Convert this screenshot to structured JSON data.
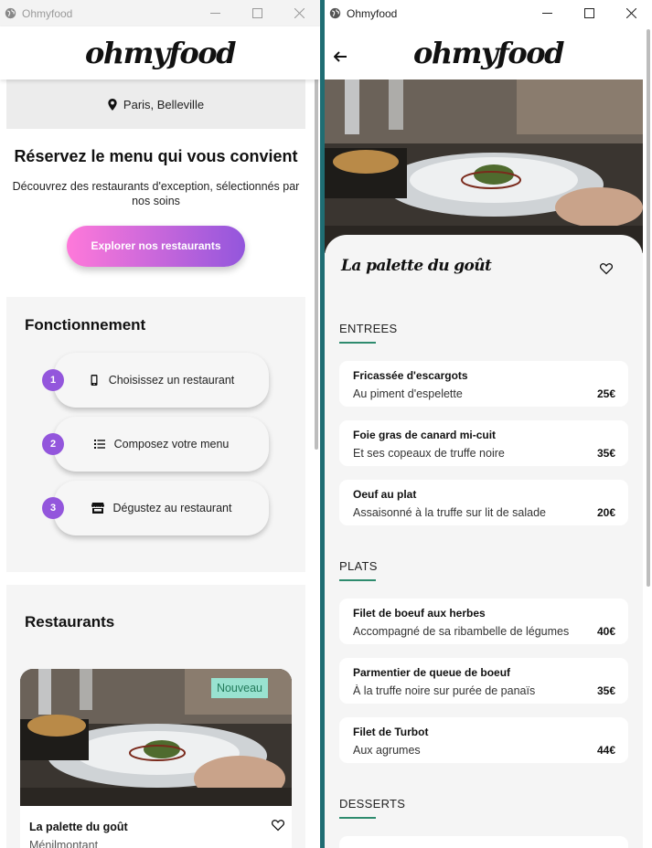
{
  "left_window": {
    "title": "Ohmyfood",
    "logo": "ohmyfood",
    "location": "Paris, Belleville",
    "hero": {
      "title": "Réservez le menu qui vous convient",
      "subtitle": "Découvrez des restaurants d'exception, sélectionnés par nos soins",
      "cta": "Explorer nos restaurants"
    },
    "how": {
      "title": "Fonctionnement",
      "steps": [
        {
          "num": "1",
          "label": "Choisissez un restaurant",
          "icon": "mobile-phone-icon"
        },
        {
          "num": "2",
          "label": "Composez votre menu",
          "icon": "list-icon"
        },
        {
          "num": "3",
          "label": "Dégustez au restaurant",
          "icon": "store-icon"
        }
      ]
    },
    "restaurants": {
      "title": "Restaurants",
      "card": {
        "badge": "Nouveau",
        "name": "La palette du goût",
        "district": "Ménilmontant"
      }
    }
  },
  "right_window": {
    "title": "Ohmyfood",
    "logo": "ohmyfood",
    "restaurant": "La palette du goût",
    "sections": [
      {
        "title": "ENTREES",
        "dishes": [
          {
            "name": "Fricassée d'escargots",
            "desc": "Au piment d'espelette",
            "price": "25€"
          },
          {
            "name": "Foie gras de canard mi-cuit",
            "desc": "Et ses copeaux de truffe noire",
            "price": "35€"
          },
          {
            "name": "Oeuf au plat",
            "desc": "Assaisonné à la truffe sur lit de salade",
            "price": "20€"
          }
        ]
      },
      {
        "title": "PLATS",
        "dishes": [
          {
            "name": "Filet de boeuf aux herbes",
            "desc": "Accompagné de sa ribambelle de légumes",
            "price": "40€"
          },
          {
            "name": "Parmentier de queue de boeuf",
            "desc": "À la truffe noire sur purée de panaïs",
            "price": "35€"
          },
          {
            "name": "Filet de Turbot",
            "desc": "Aux agrumes",
            "price": "44€"
          }
        ]
      },
      {
        "title": "DESSERTS",
        "dishes": []
      }
    ]
  },
  "colors": {
    "accent_pink": "#ff79da",
    "accent_purple": "#9356dc",
    "badge_green": "#99e2d0",
    "underline_green": "#2e8b6e"
  }
}
